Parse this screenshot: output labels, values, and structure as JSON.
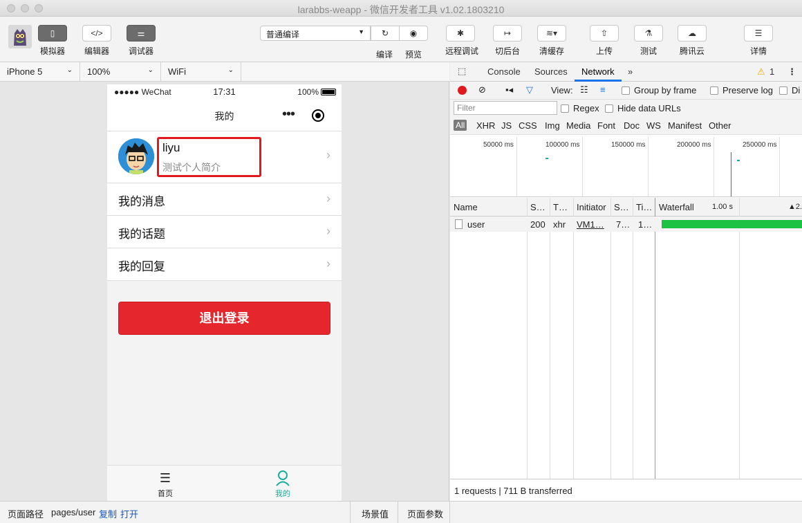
{
  "window": {
    "title": "larabbs-weapp - 微信开发者工具 v1.02.1803210"
  },
  "toolbar": {
    "simulator": "模拟器",
    "editor": "编辑器",
    "debugger": "调试器",
    "compile_mode": "普通编译",
    "compile": "编译",
    "preview": "预览",
    "remote_debug": "远程调试",
    "background": "切后台",
    "clear_cache": "清缓存",
    "upload": "上传",
    "test": "测试",
    "tencent_cloud": "腾讯云",
    "details": "详情"
  },
  "device": {
    "model": "iPhone 5",
    "zoom": "100%",
    "network": "WiFi"
  },
  "phone": {
    "carrier": "●●●●● WeChat",
    "time": "17:31",
    "battery": "100%",
    "nav_title": "我的",
    "nav_more": "•••",
    "user_name": "liyu",
    "user_bio": "测试个人简介",
    "menu": [
      {
        "label": "我的消息"
      },
      {
        "label": "我的话题"
      },
      {
        "label": "我的回复"
      }
    ],
    "logout": "退出登录",
    "tabs": {
      "home": "首页",
      "mine": "我的"
    },
    "arrow": "›",
    "colors": {
      "logout_bg": "#e5272d",
      "highlight": "#e0191e",
      "active_tab": "#1aad9b"
    }
  },
  "status": {
    "path_label": "页面路径",
    "path_value": "pages/user",
    "copy": "复制",
    "open": "打开",
    "scene": "场景值",
    "params": "页面参数"
  },
  "devtools": {
    "tabs": {
      "console": "Console",
      "sources": "Sources",
      "network": "Network",
      "more": "»"
    },
    "warning_count": "1",
    "view_label": "View:",
    "group_by_frame": "Group by frame",
    "preserve_log": "Preserve log",
    "disable_cache": "Di",
    "filter_placeholder": "Filter",
    "regex": "Regex",
    "hide_data_urls": "Hide data URLs",
    "types": [
      "All",
      "XHR",
      "JS",
      "CSS",
      "Img",
      "Media",
      "Font",
      "Doc",
      "WS",
      "Manifest",
      "Other"
    ],
    "timeline_labels": [
      "50000 ms",
      "100000 ms",
      "150000 ms",
      "200000 ms",
      "250000 ms"
    ],
    "columns": {
      "name": "Name",
      "status": "S…",
      "type": "T…",
      "initiator": "Initiator",
      "size": "S…",
      "time": "Ti…",
      "waterfall": "Waterfall",
      "wf_time": "1.00 s",
      "wf_time2": "▲2."
    },
    "rows": [
      {
        "name": "user",
        "status": "200",
        "type": "xhr",
        "initiator": "VM1…",
        "size": "7…",
        "time": "1…"
      }
    ],
    "summary": "1 requests | 711 B transferred"
  }
}
